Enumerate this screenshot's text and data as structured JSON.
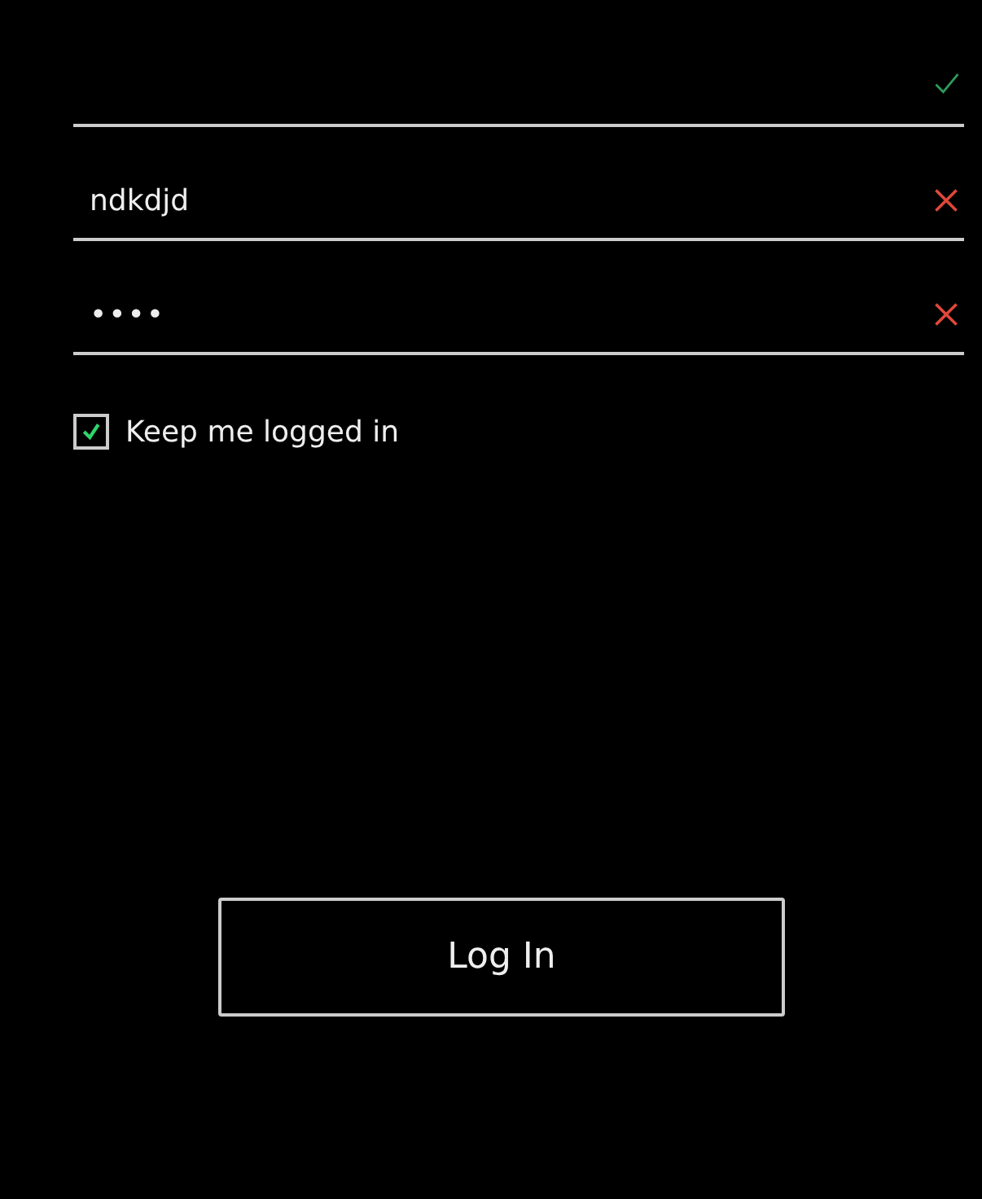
{
  "fields": [
    {
      "kind": "text",
      "valid": true
    },
    {
      "kind": "text",
      "value": "ndkdjd",
      "valid": false
    },
    {
      "kind": "password",
      "value": "••••",
      "valid": false
    }
  ],
  "keep_logged_in": {
    "label": "Keep me logged in",
    "checked": true
  },
  "login_button": {
    "label": "Log In"
  }
}
